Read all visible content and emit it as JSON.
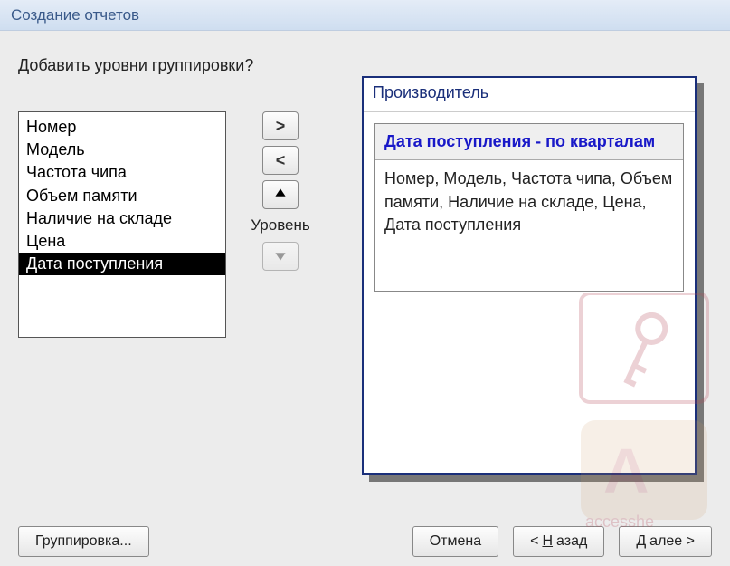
{
  "window": {
    "title": "Создание отчетов"
  },
  "prompt": "Добавить уровни группировки?",
  "fields": {
    "items": [
      {
        "label": "Номер",
        "selected": false
      },
      {
        "label": "Модель",
        "selected": false
      },
      {
        "label": "Частота чипа",
        "selected": false
      },
      {
        "label": "Объем памяти",
        "selected": false
      },
      {
        "label": "Наличие на складе",
        "selected": false
      },
      {
        "label": "Цена",
        "selected": false
      },
      {
        "label": "Дата поступления",
        "selected": true
      }
    ]
  },
  "level_label": "Уровень",
  "preview": {
    "group1": "Производитель",
    "group2": "Дата поступления - по кварталам",
    "detail": "Номер, Модель, Частота чипа, Объем памяти, Наличие на складе, Цена, Дата поступления"
  },
  "buttons": {
    "grouping": "Группировка...",
    "cancel": "Отмена",
    "back_prefix": "< ",
    "back_ul": "Н",
    "back_suffix": "азад",
    "next_ul": "Д",
    "next_suffix": "алее >"
  },
  "watermark": "accesshe"
}
